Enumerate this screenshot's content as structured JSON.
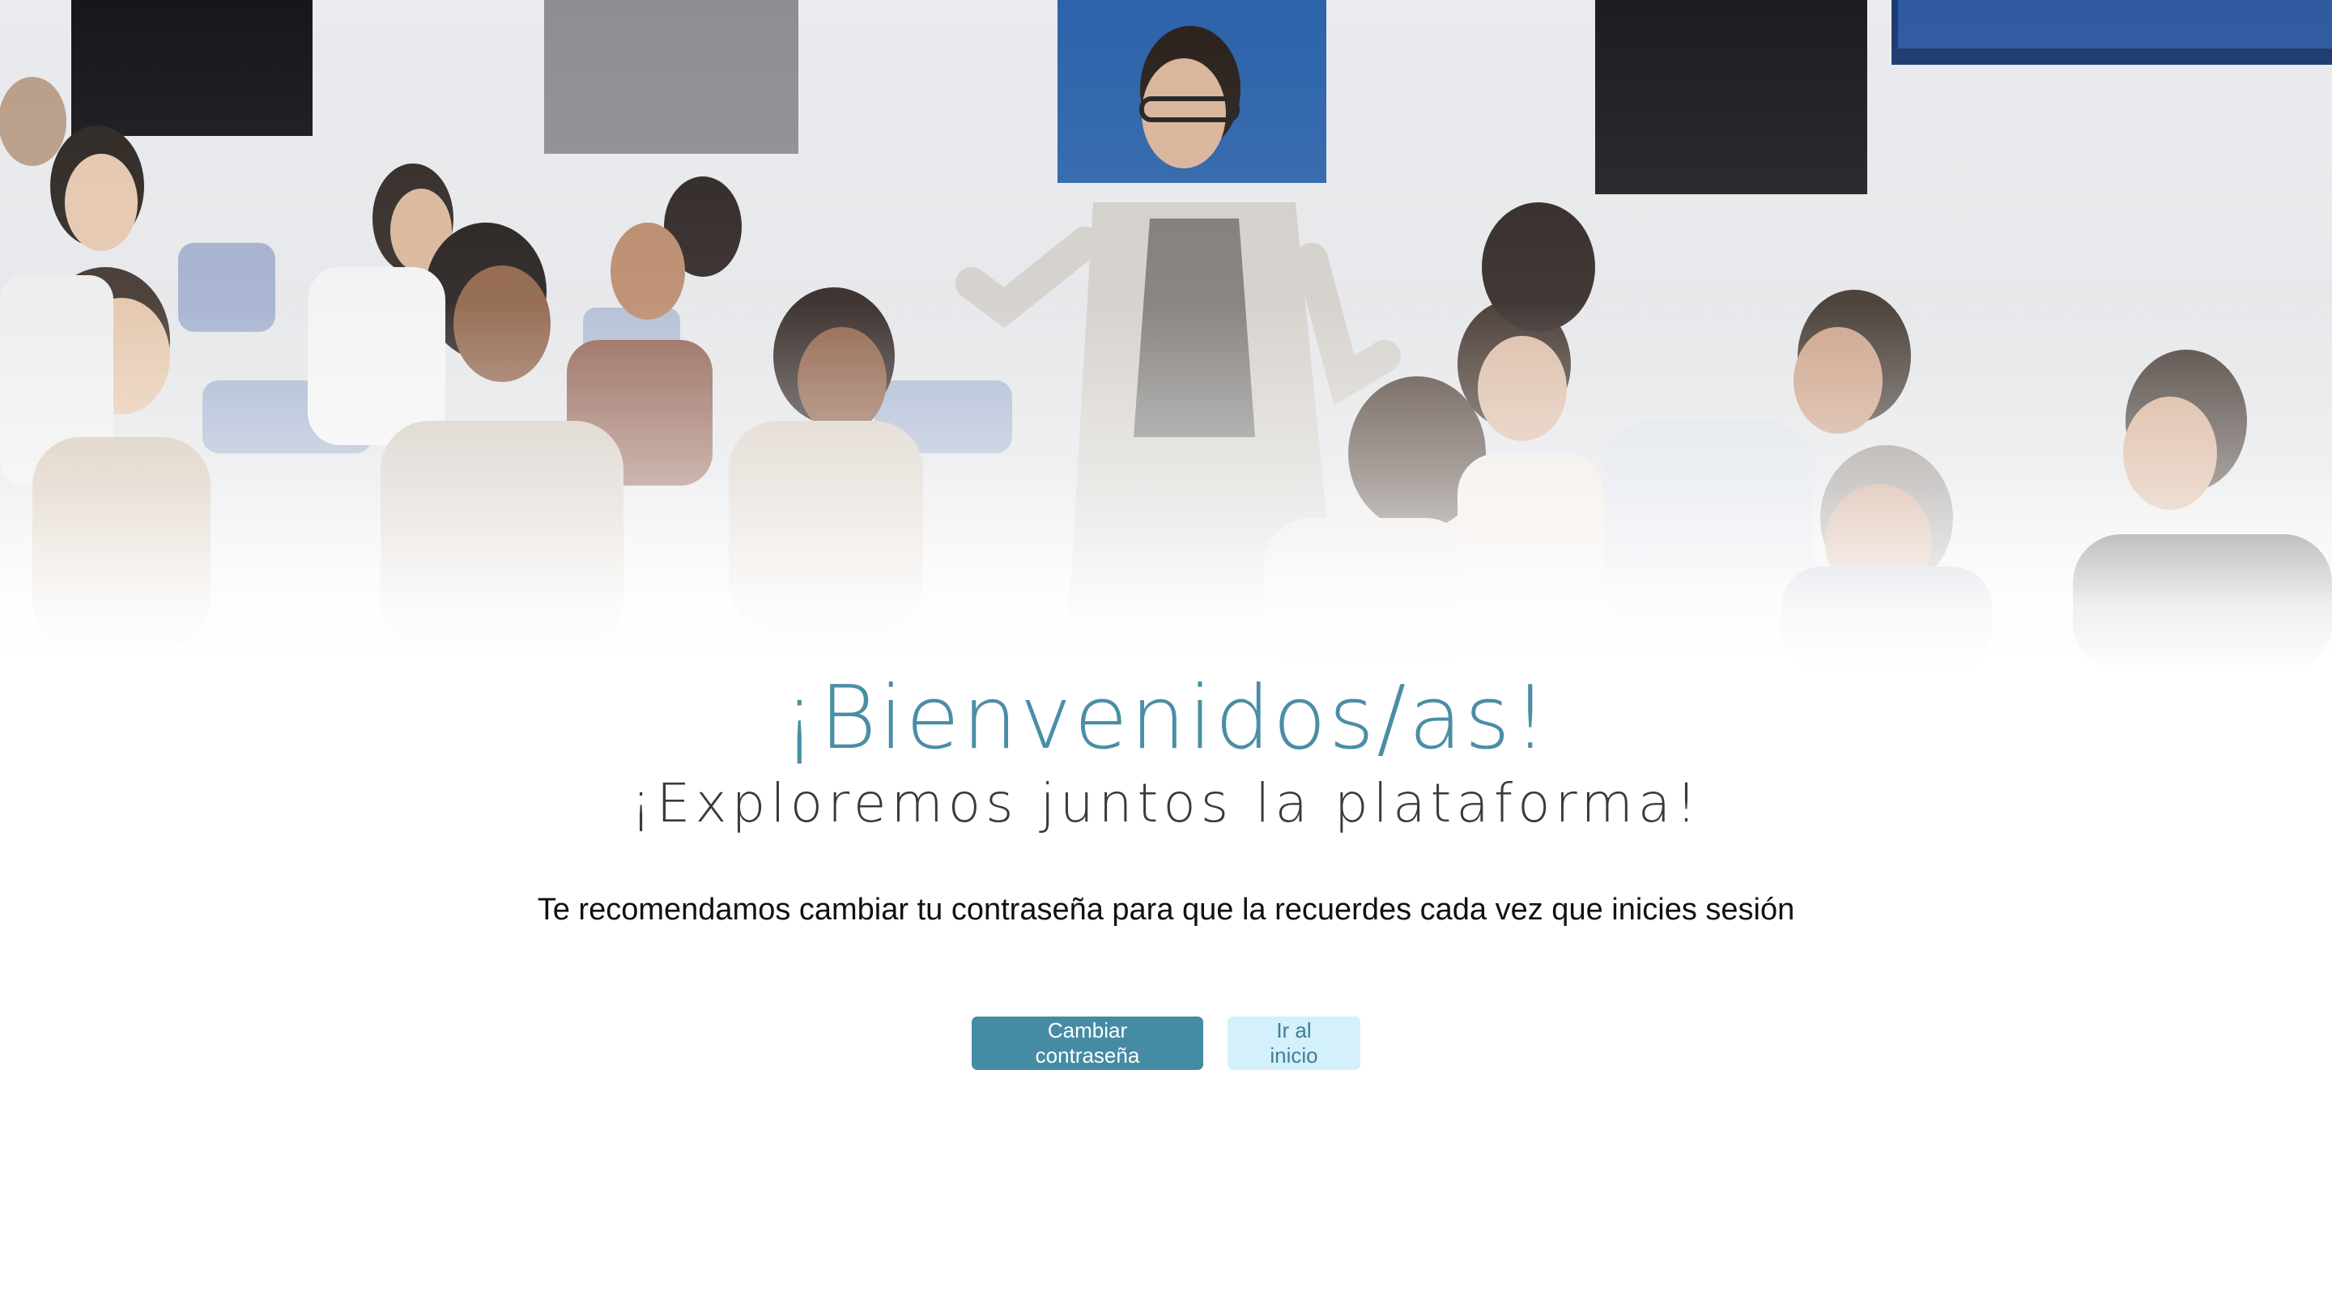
{
  "hero": {
    "image_label": "classroom-photo"
  },
  "welcome": {
    "title": "¡Bienvenidos/as!",
    "subtitle": "¡Exploremos juntos la plataforma!"
  },
  "recommendation": {
    "text": "Te recomendamos cambiar tu contraseña para que la recuerdes cada vez que inicies sesión"
  },
  "actions": {
    "change_password_label": "Cambiar contraseña",
    "go_home_label": "Ir al inicio"
  },
  "colors": {
    "accent": "#458ba3",
    "title": "#4a8ea5",
    "secondary_button_bg": "#d4f0fb",
    "secondary_button_text": "#3f7f95"
  }
}
